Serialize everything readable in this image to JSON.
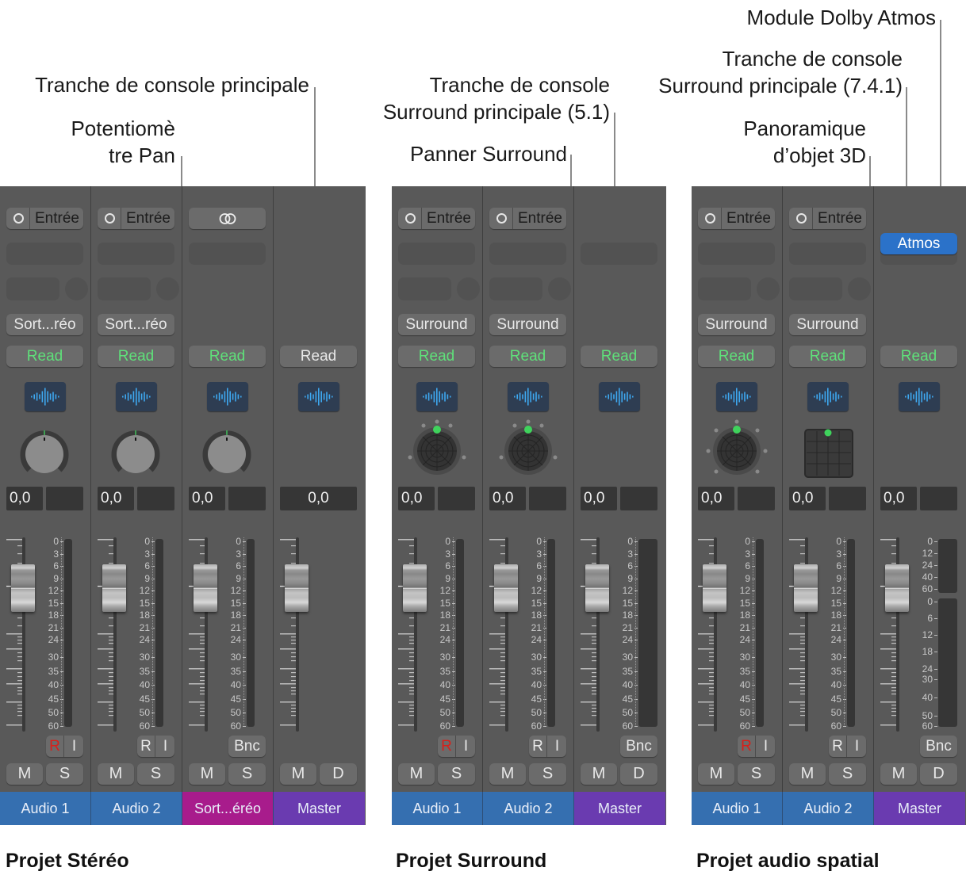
{
  "colors": {
    "audio_track": "#356fb0",
    "aux_track": "#a81c8c",
    "master_track": "#6a3bb0",
    "read_green": "#5fe07a",
    "record_red": "#d8201a",
    "atmos_blue": "#2b72c9"
  },
  "callouts": {
    "main_strip": "Tranche de console principale",
    "pan_knob_line1": "Potentiomè",
    "pan_knob_line2": "tre Pan",
    "surround_main_line1": "Tranche de console",
    "surround_main_line2": "Surround principale (5.1)",
    "surround_panner": "Panner Surround",
    "dolby_module": "Module Dolby Atmos",
    "spatial_main_line1": "Tranche de console",
    "spatial_main_line2": "Surround principale (7.4.1)",
    "object_pan_line1": "Panoramique",
    "object_pan_line2": "d’objet 3D"
  },
  "captions": {
    "stereo": "Projet Stéréo",
    "surround": "Projet Surround",
    "spatial": "Projet audio spatial"
  },
  "common": {
    "input_label": "Entrée",
    "read_label": "Read",
    "value": "0,0",
    "record_label": "R",
    "input_monitor_label": "I",
    "bounce_label": "Bnc",
    "mute_label": "M",
    "solo_label": "S",
    "dim_label": "D",
    "atmos_label": "Atmos"
  },
  "fader_scale": [
    "0",
    "3",
    "6",
    "9",
    "12",
    "15",
    "18",
    "21",
    "24",
    "30",
    "35",
    "40",
    "45",
    "50",
    "60"
  ],
  "master_scale_top": [
    "0",
    "12",
    "24",
    "40",
    "60"
  ],
  "master_scale_bottom": [
    "0",
    "6",
    "12",
    "18",
    "24",
    "30",
    "40",
    "50",
    "60"
  ],
  "panels": {
    "stereo": {
      "strips": [
        {
          "name": "Audio 1",
          "output": "Sort...réo",
          "type": "audio",
          "record_armed": true
        },
        {
          "name": "Audio 2",
          "output": "Sort...réo",
          "type": "audio",
          "record_armed": false
        },
        {
          "name": "Sort...éréo",
          "type": "aux"
        },
        {
          "name": "Master",
          "type": "master"
        }
      ]
    },
    "surround": {
      "strips": [
        {
          "name": "Audio 1",
          "output": "Surround",
          "type": "audio",
          "record_armed": true
        },
        {
          "name": "Audio 2",
          "output": "Surround",
          "type": "audio",
          "record_armed": false
        },
        {
          "name": "Master",
          "type": "master"
        }
      ]
    },
    "spatial": {
      "strips": [
        {
          "name": "Audio 1",
          "output": "Surround",
          "type": "audio",
          "record_armed": true
        },
        {
          "name": "Audio 2",
          "output": "Surround",
          "type": "audio",
          "record_armed": false
        },
        {
          "name": "Master",
          "type": "master"
        }
      ]
    }
  }
}
